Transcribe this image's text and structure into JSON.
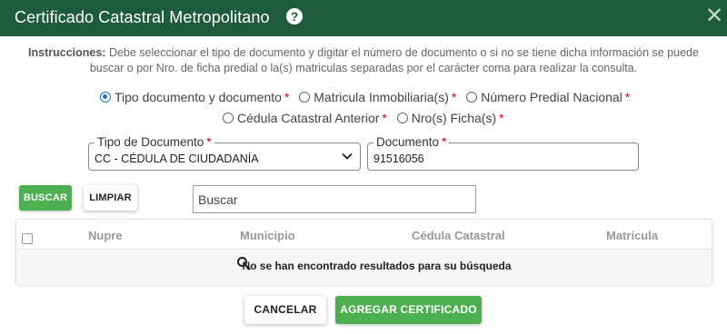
{
  "dialog": {
    "title": "Certificado Catastral Metropolitano",
    "help_glyph": "?",
    "close_glyph": "✕"
  },
  "instructions": {
    "label": "Instrucciones:",
    "text": " Debe seleccionar el tipo de documento y digitar el número de documento o si no se tiene dicha información se puede buscar o por Nro. de ficha predial o la(s) matriculas separadas por el carácter coma para realizar la consulta."
  },
  "search_options": [
    {
      "label": "Tipo documento y documento",
      "selected": true
    },
    {
      "label": "Matricula Inmobiliaria(s)",
      "selected": false
    },
    {
      "label": "Número Predial Nacional",
      "selected": false
    },
    {
      "label": "Cédula Catastral Anterior",
      "selected": false
    },
    {
      "label": "Nro(s) Ficha(s)",
      "selected": false
    }
  ],
  "required_mark": "*",
  "form": {
    "doc_type_label": "Tipo de Documento",
    "doc_type_value": "CC - CÉDULA DE CIUDADANÍA",
    "document_label": "Documento",
    "document_value": "91516056"
  },
  "actions": {
    "search": "BUSCAR",
    "clear": "LIMPIAR",
    "search_placeholder": "Buscar"
  },
  "table": {
    "columns": [
      "Nupre",
      "Municipio",
      "Cédula Catastral",
      "Matrícula"
    ],
    "empty_message": "No se han encontrado resultados para su búsqueda"
  },
  "footer": {
    "cancel": "CANCELAR",
    "add": "AGREGAR CERTIFICADO"
  },
  "colors": {
    "header_bg": "#1e5b3d",
    "accent_green": "#4caf50",
    "radio_selected": "#1a73c8",
    "required": "#d0021b"
  }
}
